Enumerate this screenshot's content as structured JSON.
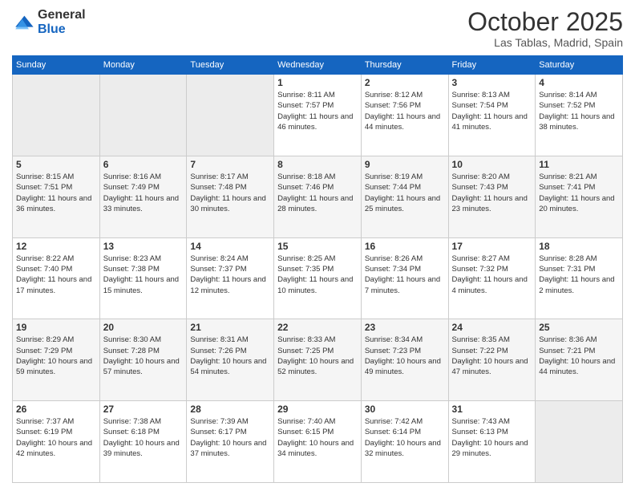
{
  "header": {
    "logo_general": "General",
    "logo_blue": "Blue",
    "month_title": "October 2025",
    "location": "Las Tablas, Madrid, Spain"
  },
  "days_of_week": [
    "Sunday",
    "Monday",
    "Tuesday",
    "Wednesday",
    "Thursday",
    "Friday",
    "Saturday"
  ],
  "weeks": [
    [
      {
        "day": "",
        "empty": true
      },
      {
        "day": "",
        "empty": true
      },
      {
        "day": "",
        "empty": true
      },
      {
        "day": "1",
        "sunrise": "8:11 AM",
        "sunset": "7:57 PM",
        "daylight": "11 hours and 46 minutes."
      },
      {
        "day": "2",
        "sunrise": "8:12 AM",
        "sunset": "7:56 PM",
        "daylight": "11 hours and 44 minutes."
      },
      {
        "day": "3",
        "sunrise": "8:13 AM",
        "sunset": "7:54 PM",
        "daylight": "11 hours and 41 minutes."
      },
      {
        "day": "4",
        "sunrise": "8:14 AM",
        "sunset": "7:52 PM",
        "daylight": "11 hours and 38 minutes."
      }
    ],
    [
      {
        "day": "5",
        "sunrise": "8:15 AM",
        "sunset": "7:51 PM",
        "daylight": "11 hours and 36 minutes."
      },
      {
        "day": "6",
        "sunrise": "8:16 AM",
        "sunset": "7:49 PM",
        "daylight": "11 hours and 33 minutes."
      },
      {
        "day": "7",
        "sunrise": "8:17 AM",
        "sunset": "7:48 PM",
        "daylight": "11 hours and 30 minutes."
      },
      {
        "day": "8",
        "sunrise": "8:18 AM",
        "sunset": "7:46 PM",
        "daylight": "11 hours and 28 minutes."
      },
      {
        "day": "9",
        "sunrise": "8:19 AM",
        "sunset": "7:44 PM",
        "daylight": "11 hours and 25 minutes."
      },
      {
        "day": "10",
        "sunrise": "8:20 AM",
        "sunset": "7:43 PM",
        "daylight": "11 hours and 23 minutes."
      },
      {
        "day": "11",
        "sunrise": "8:21 AM",
        "sunset": "7:41 PM",
        "daylight": "11 hours and 20 minutes."
      }
    ],
    [
      {
        "day": "12",
        "sunrise": "8:22 AM",
        "sunset": "7:40 PM",
        "daylight": "11 hours and 17 minutes."
      },
      {
        "day": "13",
        "sunrise": "8:23 AM",
        "sunset": "7:38 PM",
        "daylight": "11 hours and 15 minutes."
      },
      {
        "day": "14",
        "sunrise": "8:24 AM",
        "sunset": "7:37 PM",
        "daylight": "11 hours and 12 minutes."
      },
      {
        "day": "15",
        "sunrise": "8:25 AM",
        "sunset": "7:35 PM",
        "daylight": "11 hours and 10 minutes."
      },
      {
        "day": "16",
        "sunrise": "8:26 AM",
        "sunset": "7:34 PM",
        "daylight": "11 hours and 7 minutes."
      },
      {
        "day": "17",
        "sunrise": "8:27 AM",
        "sunset": "7:32 PM",
        "daylight": "11 hours and 4 minutes."
      },
      {
        "day": "18",
        "sunrise": "8:28 AM",
        "sunset": "7:31 PM",
        "daylight": "11 hours and 2 minutes."
      }
    ],
    [
      {
        "day": "19",
        "sunrise": "8:29 AM",
        "sunset": "7:29 PM",
        "daylight": "10 hours and 59 minutes."
      },
      {
        "day": "20",
        "sunrise": "8:30 AM",
        "sunset": "7:28 PM",
        "daylight": "10 hours and 57 minutes."
      },
      {
        "day": "21",
        "sunrise": "8:31 AM",
        "sunset": "7:26 PM",
        "daylight": "10 hours and 54 minutes."
      },
      {
        "day": "22",
        "sunrise": "8:33 AM",
        "sunset": "7:25 PM",
        "daylight": "10 hours and 52 minutes."
      },
      {
        "day": "23",
        "sunrise": "8:34 AM",
        "sunset": "7:23 PM",
        "daylight": "10 hours and 49 minutes."
      },
      {
        "day": "24",
        "sunrise": "8:35 AM",
        "sunset": "7:22 PM",
        "daylight": "10 hours and 47 minutes."
      },
      {
        "day": "25",
        "sunrise": "8:36 AM",
        "sunset": "7:21 PM",
        "daylight": "10 hours and 44 minutes."
      }
    ],
    [
      {
        "day": "26",
        "sunrise": "7:37 AM",
        "sunset": "6:19 PM",
        "daylight": "10 hours and 42 minutes."
      },
      {
        "day": "27",
        "sunrise": "7:38 AM",
        "sunset": "6:18 PM",
        "daylight": "10 hours and 39 minutes."
      },
      {
        "day": "28",
        "sunrise": "7:39 AM",
        "sunset": "6:17 PM",
        "daylight": "10 hours and 37 minutes."
      },
      {
        "day": "29",
        "sunrise": "7:40 AM",
        "sunset": "6:15 PM",
        "daylight": "10 hours and 34 minutes."
      },
      {
        "day": "30",
        "sunrise": "7:42 AM",
        "sunset": "6:14 PM",
        "daylight": "10 hours and 32 minutes."
      },
      {
        "day": "31",
        "sunrise": "7:43 AM",
        "sunset": "6:13 PM",
        "daylight": "10 hours and 29 minutes."
      },
      {
        "day": "",
        "empty": true
      }
    ]
  ]
}
